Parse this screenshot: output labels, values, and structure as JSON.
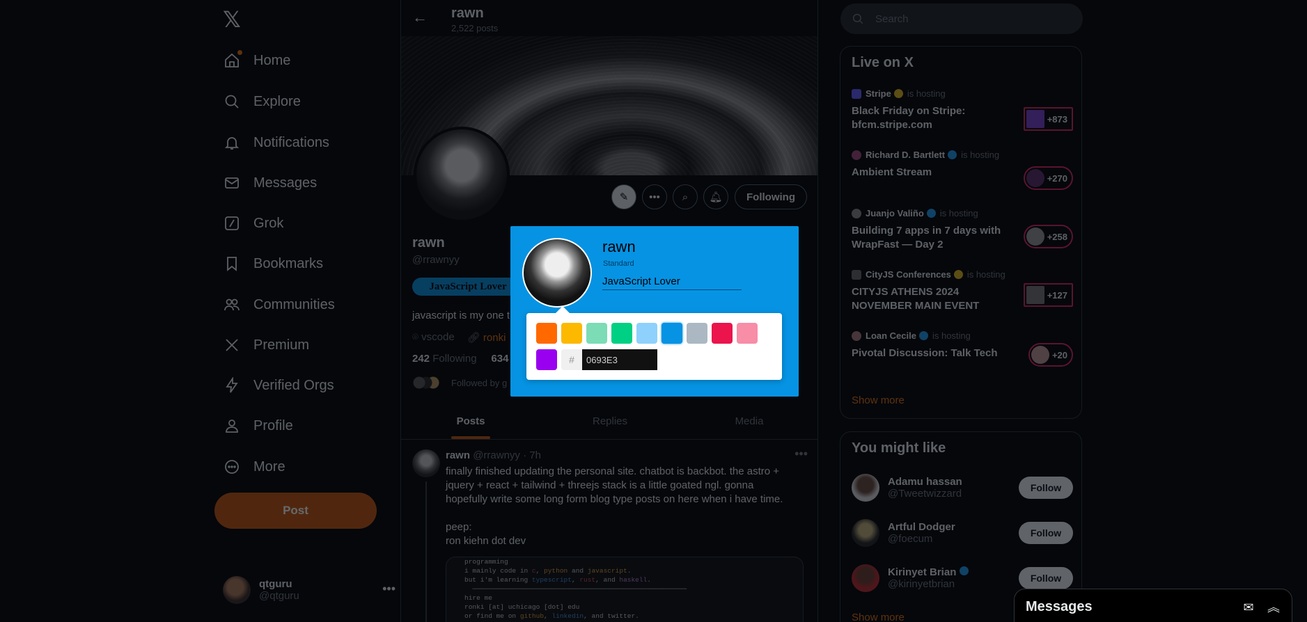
{
  "nav": {
    "items": [
      {
        "label": "Home",
        "icon": "home-icon"
      },
      {
        "label": "Explore",
        "icon": "search-icon"
      },
      {
        "label": "Notifications",
        "icon": "bell-icon"
      },
      {
        "label": "Messages",
        "icon": "mail-icon"
      },
      {
        "label": "Grok",
        "icon": "grok-icon"
      },
      {
        "label": "Bookmarks",
        "icon": "bookmark-icon"
      },
      {
        "label": "Communities",
        "icon": "people-icon"
      },
      {
        "label": "Premium",
        "icon": "x-icon"
      },
      {
        "label": "Verified Orgs",
        "icon": "lightning-icon"
      },
      {
        "label": "Profile",
        "icon": "person-icon"
      },
      {
        "label": "More",
        "icon": "more-circle-icon"
      }
    ],
    "post_label": "Post",
    "account": {
      "name": "qtguru",
      "handle": "@qtguru"
    }
  },
  "header": {
    "title": "rawn",
    "subtitle": "2,522 posts"
  },
  "profile": {
    "name": "rawn",
    "handle": "@rrawnyy",
    "tag": "JavaScript Lover",
    "bio": "javascript is my one t",
    "location": "vscode",
    "link": "ronki",
    "following_count": "242",
    "following_label": "Following",
    "followers_count": "634",
    "followed_by": "Followed by g",
    "following_button": "Following"
  },
  "tabs": [
    "Posts",
    "Replies",
    "Media"
  ],
  "post": {
    "name": "rawn",
    "meta": "@rrawnyy · 7h",
    "text": "finally finished updating the personal site. chatbot is backbot. the astro +\njquery + react + tailwind + threejs stack is a little goated ngl. gonna\nhopefully write some long form blog type posts on here when i have time.\n\npeep:\nron kiehn dot dev",
    "code_lines": {
      "l0": "programming",
      "l1a": "i mainly code in ",
      "l1b": "c",
      "l1c": ", ",
      "l1d": "python",
      "l1e": " and ",
      "l1f": "javascript",
      "l1g": ".",
      "l2a": "but i'm learning ",
      "l2b": "typescript",
      "l2c": ", ",
      "l2d": "rust",
      "l2e": ", and ",
      "l2f": "haskell",
      "l2g": ".",
      "l3": "hire me",
      "l4": "ronki [at] uchicago [dot] edu",
      "l5a": "or find me on ",
      "l5b": "github",
      "l5c": ", ",
      "l5d": "linkedin",
      "l5e": ", and twitter."
    }
  },
  "search": {
    "placeholder": "Search"
  },
  "live": {
    "title": "Live on X",
    "host_suffix": "is hosting",
    "items": [
      {
        "host": "Stripe",
        "title": "Black Friday on Stripe: bfcm.stripe.com",
        "count": "+873"
      },
      {
        "host": "Richard D. Bartlett",
        "title": "Ambient Stream",
        "count": "+270"
      },
      {
        "host": "Juanjo Valiño",
        "title": "Building 7 apps in 7 days with WrapFast — Day 2",
        "count": "+258"
      },
      {
        "host": "CityJS Conferences",
        "title": "CITYJS ATHENS 2024 NOVEMBER MAIN EVENT",
        "count": "+127"
      },
      {
        "host": "Loan Cecile",
        "title": "Pivotal Discussion: Talk Tech",
        "count": "+20"
      }
    ],
    "show_more": "Show more"
  },
  "wtf": {
    "title": "You might like",
    "items": [
      {
        "name": "Adamu hassan",
        "handle": "@Tweetwizzard",
        "button": "Follow"
      },
      {
        "name": "Artful Dodger",
        "handle": "@foecum",
        "button": "Follow"
      },
      {
        "name": "Kirinyet Brian",
        "handle": "@kirinyetbrian",
        "button": "Follow"
      }
    ],
    "show_more": "Show more"
  },
  "messages_dock": {
    "title": "Messages"
  },
  "popup": {
    "name": "rawn",
    "type": "Standard",
    "tag_value": "JavaScript Lover",
    "hash": "#",
    "hex_value": "0693E3",
    "swatches": [
      "#FF6900",
      "#FCB900",
      "#7BDCB5",
      "#00D084",
      "#8ED1FC",
      "#0693E3",
      "#ABB8C3",
      "#EB144C",
      "#F78DA7",
      "#9900EF"
    ],
    "selected_swatch": "#0693E3"
  },
  "colors": {
    "accent": "#c4560a",
    "tag_bg": "#0693e3",
    "live_ring": "#e0245e"
  }
}
